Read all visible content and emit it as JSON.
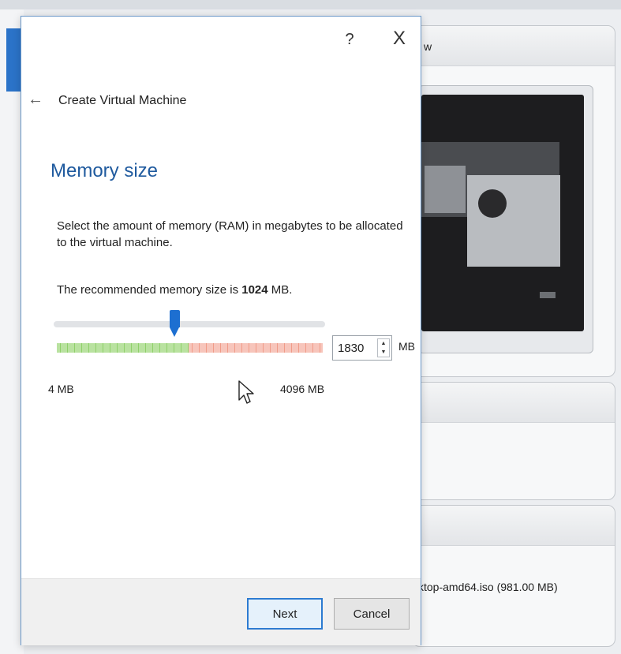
{
  "dialog": {
    "help_label": "?",
    "close_label": "X",
    "back_label": "←",
    "title": "Create Virtual Machine",
    "section_title": "Memory size",
    "description": "Select the amount of memory (RAM) in megabytes to be allocated to the virtual machine.",
    "recommend_prefix": "The recommended memory size is ",
    "recommend_value": "1024",
    "recommend_suffix": " MB.",
    "memory": {
      "value": "1830",
      "unit": "MB",
      "min_label": "4 MB",
      "max_label": "4096 MB",
      "slider_fraction": 0.446
    },
    "buttons": {
      "next": "Next",
      "cancel": "Cancel"
    }
  },
  "background": {
    "panel_header_fragment": "w",
    "iso_label": "ktop-amd64.iso (981.00 MB)",
    "paren_fragment": ")"
  },
  "colors": {
    "accent": "#1d6fd1",
    "title_blue": "#1f5a9e",
    "safe_zone": "#b9e2a0",
    "warn_zone": "#f7c5bb"
  }
}
